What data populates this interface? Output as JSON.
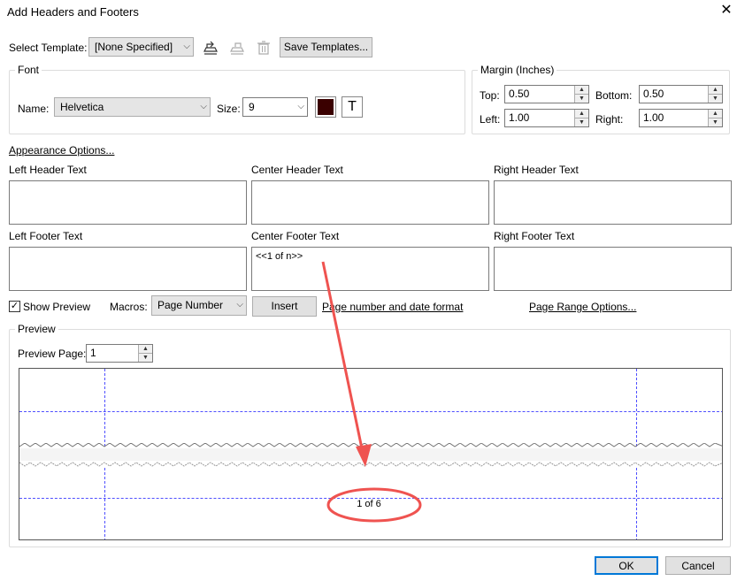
{
  "window": {
    "title": "Add Headers and Footers",
    "close_icon": "close-icon"
  },
  "template": {
    "label": "Select Template:",
    "selected": "[None Specified]",
    "save_button": "Save Templates..."
  },
  "font": {
    "group_title": "Font",
    "name_label": "Name:",
    "name_value": "Helvetica",
    "size_label": "Size:",
    "size_value": "9",
    "color": "#3a0000"
  },
  "margin": {
    "group_title": "Margin (Inches)",
    "top_label": "Top:",
    "top_value": "0.50",
    "bottom_label": "Bottom:",
    "bottom_value": "0.50",
    "left_label": "Left:",
    "left_value": "1.00",
    "right_label": "Right:",
    "right_value": "1.00"
  },
  "appearance_link": "Appearance Options...",
  "headers": {
    "left_label": "Left Header Text",
    "left_value": "",
    "center_label": "Center Header Text",
    "center_value": "",
    "right_label": "Right Header Text",
    "right_value": ""
  },
  "footers": {
    "left_label": "Left Footer Text",
    "left_value": "",
    "center_label": "Center Footer Text",
    "center_value": "<<1 of n>>",
    "right_label": "Right Footer Text",
    "right_value": ""
  },
  "options": {
    "show_preview_label": "Show Preview",
    "show_preview_checked": true,
    "macros_label": "Macros:",
    "macros_value": "Page Number",
    "insert_button": "Insert",
    "page_number_link": "Page number and date format",
    "page_range_link": "Page Range Options..."
  },
  "preview": {
    "group_title": "Preview",
    "page_label": "Preview Page:",
    "page_value": "1",
    "footer_sample": "1 of 6"
  },
  "annotation": {
    "color": "#ef5350"
  },
  "dialog_buttons": {
    "ok": "OK",
    "cancel": "Cancel"
  }
}
